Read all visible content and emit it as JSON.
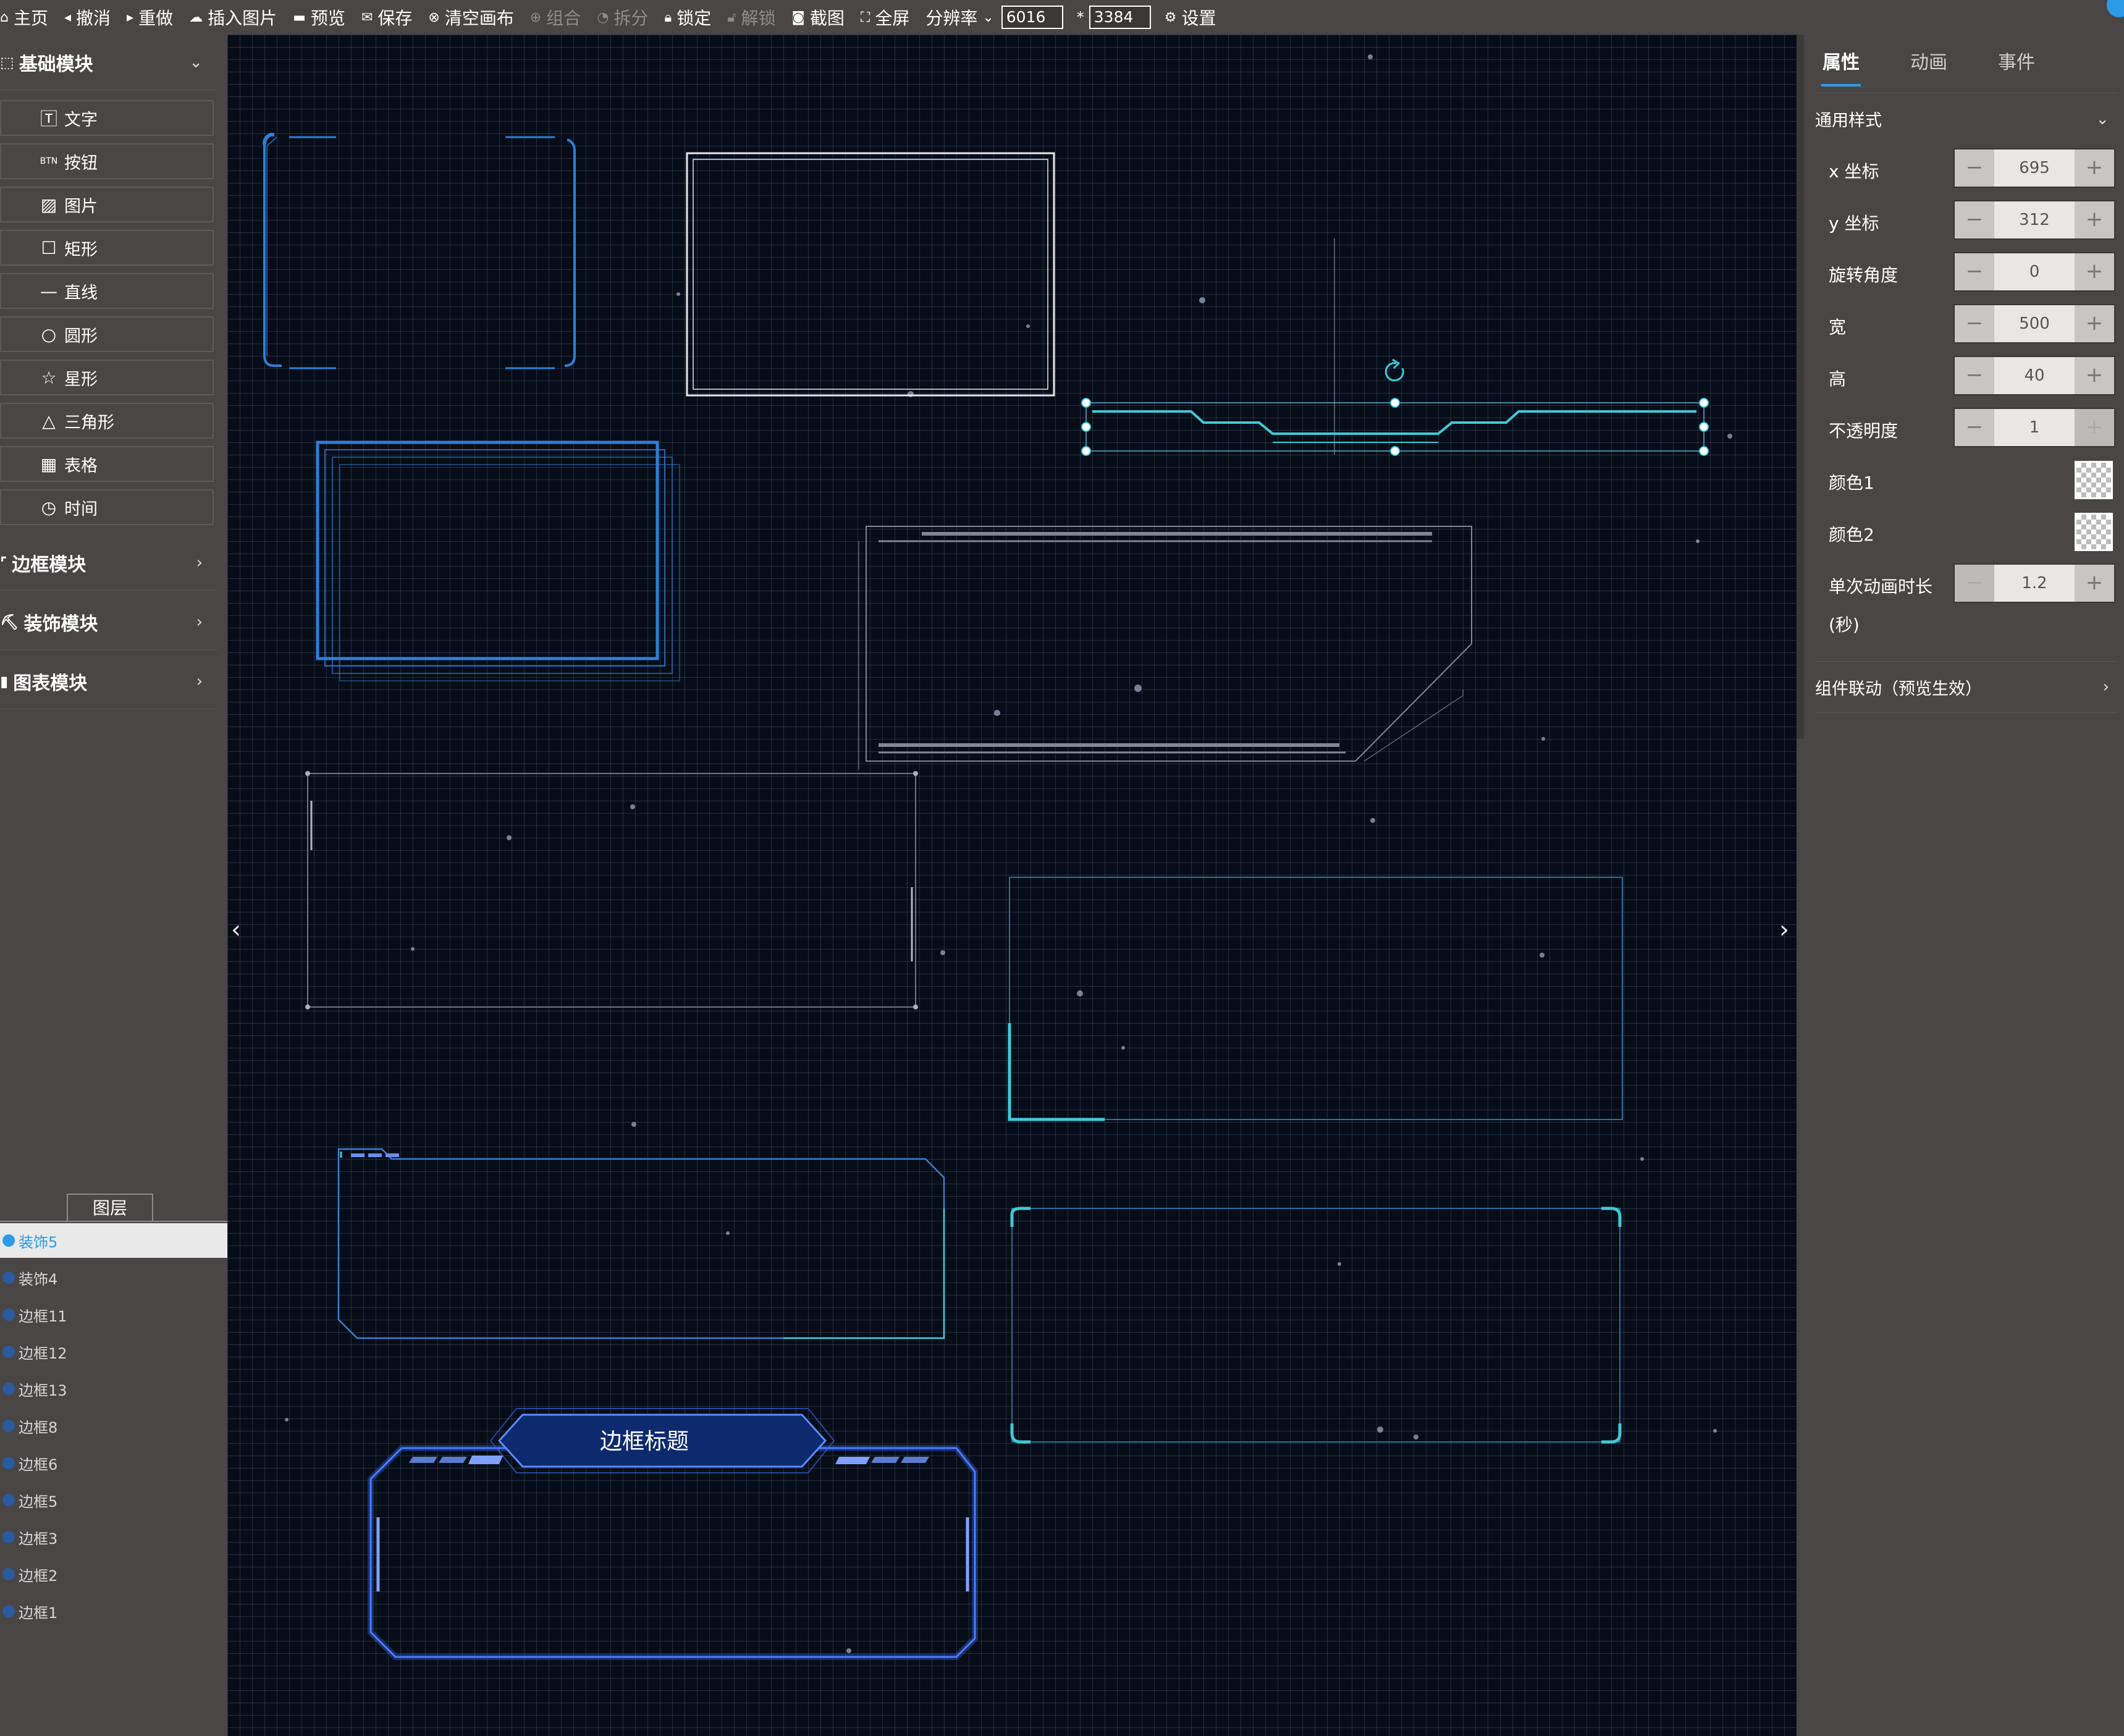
{
  "toolbar": {
    "home": "主页",
    "undo": "撤消",
    "redo": "重做",
    "insert_image": "插入图片",
    "preview": "预览",
    "save": "保存",
    "clear_canvas": "清空画布",
    "group": "组合",
    "ungroup": "拆分",
    "lock": "锁定",
    "unlock": "解锁",
    "screenshot": "截图",
    "fullscreen": "全屏",
    "resolution_label": "分辨率",
    "resolution_width": "6016",
    "resolution_sep": "*",
    "resolution_height": "3384",
    "settings": "设置"
  },
  "sidebar": {
    "basic_group": "基础模块",
    "basic_items": [
      "文字",
      "按钮",
      "图片",
      "矩形",
      "直线",
      "圆形",
      "星形",
      "三角形",
      "表格",
      "时间"
    ],
    "border_group": "边框模块",
    "decor_group": "装饰模块",
    "chart_group": "图表模块",
    "layer_tab": "图层",
    "layers": [
      "装饰5",
      "装饰4",
      "边框11",
      "边框12",
      "边框13",
      "边框8",
      "边框6",
      "边框5",
      "边框3",
      "边框2",
      "边框1"
    ],
    "selected_layer": "装饰5"
  },
  "canvas": {
    "frame_title": "边框标题",
    "colors": {
      "background": "#070d18",
      "grid": "#5a6e8c",
      "accent_blue": "#2e7fd8",
      "accent_cyan": "#3fc9d6"
    }
  },
  "panel": {
    "tabs": [
      "属性",
      "动画",
      "事件"
    ],
    "active_tab": "属性",
    "section_general": "通用样式",
    "props": [
      {
        "label": "x 坐标",
        "value": "695"
      },
      {
        "label": "y 坐标",
        "value": "312"
      },
      {
        "label": "旋转角度",
        "value": "0"
      },
      {
        "label": "宽",
        "value": "500"
      },
      {
        "label": "高",
        "value": "40"
      },
      {
        "label": "不透明度",
        "value": "1"
      }
    ],
    "color1_label": "颜色1",
    "color2_label": "颜色2",
    "duration_label": "单次动画时长",
    "duration_unit": "(秒)",
    "duration_value": "1.2",
    "linkage_section": "组件联动（预览生效）"
  }
}
